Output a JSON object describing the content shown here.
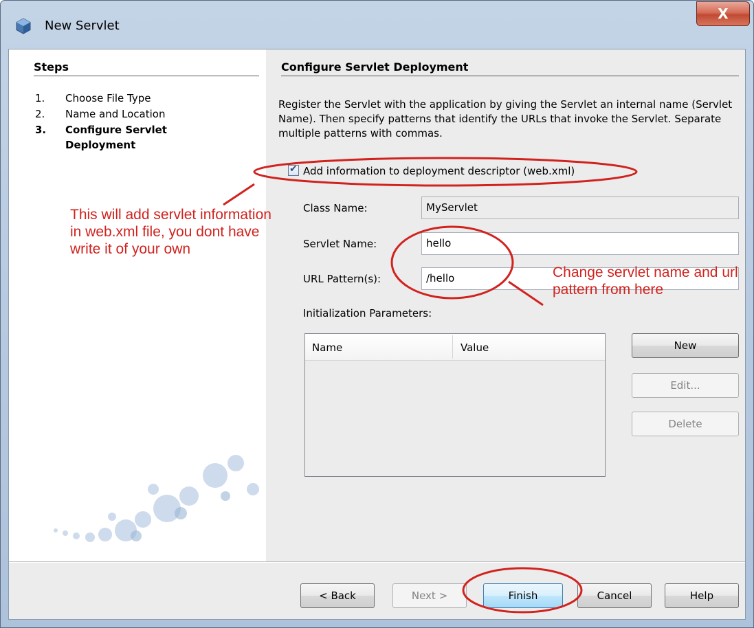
{
  "window": {
    "title": "New Servlet",
    "close_label": "X"
  },
  "steps": {
    "heading": "Steps",
    "items": [
      {
        "num": "1.",
        "label": "Choose File Type"
      },
      {
        "num": "2.",
        "label": "Name and Location"
      },
      {
        "num": "3.",
        "label": "Configure Servlet Deployment"
      }
    ]
  },
  "main": {
    "heading": "Configure Servlet Deployment",
    "description": "Register the Servlet with the application by giving the Servlet an internal name (Servlet Name). Then specify patterns that identify the URLs that invoke the Servlet. Separate multiple patterns with commas.",
    "checkbox_label": "Add information to deployment descriptor (web.xml)",
    "checkbox_checked": true,
    "class_name_label": "Class Name:",
    "class_name_value": "MyServlet",
    "servlet_name_label": "Servlet Name:",
    "servlet_name_value": "hello",
    "url_pattern_label": "URL Pattern(s):",
    "url_pattern_value": "/hello",
    "init_params_label": "Initialization Parameters:",
    "table_columns": [
      "Name",
      "Value"
    ],
    "new_button": "New",
    "edit_button": "Edit...",
    "delete_button": "Delete"
  },
  "footer": {
    "back": "< Back",
    "next": "Next >",
    "finish": "Finish",
    "cancel": "Cancel",
    "help": "Help"
  },
  "annotations": {
    "left_note": "This will add servlet information in web.xml file, you dont have write it of your own",
    "right_note": "Change servlet name and url pattern from here",
    "color": "#d1221e"
  }
}
